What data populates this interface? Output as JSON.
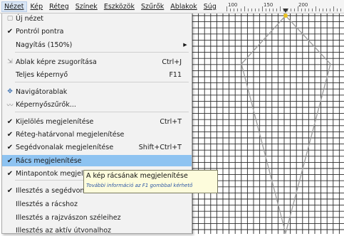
{
  "menubar": {
    "items": [
      "Nézet",
      "Kép",
      "Réteg",
      "Színek",
      "Eszközök",
      "Szűrők",
      "Ablakok",
      "Súg"
    ]
  },
  "ruler": {
    "labels": [
      "100",
      "150",
      "200"
    ]
  },
  "menu": {
    "items": [
      {
        "icon": "new-view-icon",
        "glyph": "▢",
        "label": "Új nézet",
        "shortcut": ""
      },
      {
        "icon": "check-icon",
        "glyph": "✔",
        "label": "Pontról pontra",
        "shortcut": ""
      },
      {
        "icon": "",
        "glyph": "",
        "label": "Nagyítás (150%)",
        "shortcut": "",
        "submenu": true
      },
      {
        "icon": "shrink-window-icon",
        "glyph": "⇲",
        "label": "Ablak képre zsugorítása",
        "shortcut": "Ctrl+J"
      },
      {
        "icon": "",
        "glyph": "",
        "label": "Teljes képernyő",
        "shortcut": "F11"
      },
      {
        "icon": "navigator-icon",
        "glyph": "✥",
        "label": "Navigátorablak",
        "shortcut": ""
      },
      {
        "icon": "display-filters-icon",
        "glyph": "〰",
        "label": "Képernyőszűrők...",
        "shortcut": ""
      },
      {
        "icon": "check-icon",
        "glyph": "✔",
        "label": "Kijelölés megjelenítése",
        "shortcut": "Ctrl+T"
      },
      {
        "icon": "check-icon",
        "glyph": "✔",
        "label": "Réteg-határvonal megjelenítése",
        "shortcut": ""
      },
      {
        "icon": "check-icon",
        "glyph": "✔",
        "label": "Segédvonalak megjelenítése",
        "shortcut": "Shift+Ctrl+T"
      },
      {
        "icon": "check-icon",
        "glyph": "✔",
        "label": "Rács megjelenítése",
        "shortcut": ""
      },
      {
        "icon": "check-icon",
        "glyph": "✔",
        "label": "Mintapontok megjelenítése",
        "shortcut": ""
      },
      {
        "icon": "check-icon",
        "glyph": "✔",
        "label": "Illesztés a segédvonalakhoz",
        "shortcut": ""
      },
      {
        "icon": "",
        "glyph": "",
        "label": "Illesztés a rácshoz",
        "shortcut": ""
      },
      {
        "icon": "",
        "glyph": "",
        "label": "Illesztés a rajzvászon széleihez",
        "shortcut": ""
      },
      {
        "icon": "",
        "glyph": "",
        "label": "Illesztés az aktív útvonalhoz",
        "shortcut": ""
      }
    ]
  },
  "tooltip": {
    "title": "A kép rácsának megjelenítése",
    "hint": "További információ az F1 gombbal kérhető"
  },
  "colors": {
    "highlight": "#8ec3f1",
    "tooltip_bg": "#fdfcdc",
    "hint_text": "#2b55a5",
    "guide_line": "#a0a0a0",
    "anchor": "#e8c020"
  }
}
